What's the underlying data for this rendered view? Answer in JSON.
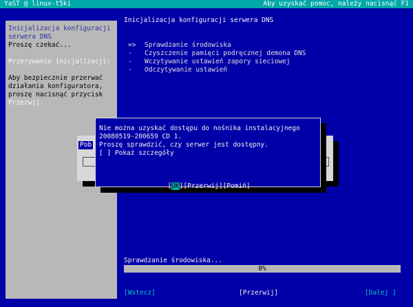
{
  "topbar": {
    "left": "YaST @ linux-t5ki",
    "right": "Aby uzyskać pomoc, należy nacisnąć F1"
  },
  "help_panel": {
    "lines": [
      "Inicjalizacja konfiguracji",
      "serwera DNS",
      "Proszę czekać...",
      "",
      "Przerywanie inicjalizacji:",
      "",
      "Aby bezpiecznie przerwać",
      "działania konfiguratora,",
      "proszę nacisnąć przycisk",
      "Przerwij."
    ]
  },
  "main": {
    "title": "Inicjalizacja konfiguracji serwera DNS",
    "steps": [
      {
        "marker": "=>",
        "label": "Sprawdzanie środowiska"
      },
      {
        "marker": "-",
        "label": "Czyszczenie pamięci podręcznej demona DNS"
      },
      {
        "marker": "-",
        "label": "Wczytywanie ustawień zapory sieciowej"
      },
      {
        "marker": "-",
        "label": "Odczytywanie ustawień"
      }
    ]
  },
  "background_popup": {
    "label": "Pob"
  },
  "dialog": {
    "message_line1": "Nie można uzyskać dostępu do nośnika instalacyjnego",
    "message_line2": "20080519-200659 CD 1.",
    "message_line3": "Proszę sprawdzić, czy serwer jest dostępny.",
    "checkbox_label": "[ ] Pokaż szczegóły",
    "ok_label": "OK",
    "ok_left_bracket": "[",
    "ok_right_bracket": "]",
    "abort_label": "[Przerwij]",
    "skip_label": "[Pomiń]"
  },
  "progress": {
    "status_text": "Sprawdzanie środowiska...",
    "percent_label": "0%",
    "value": 0
  },
  "buttons": {
    "back": "[Wstecz]",
    "abort": "[Przerwij]",
    "next": "[Dalej ]"
  }
}
